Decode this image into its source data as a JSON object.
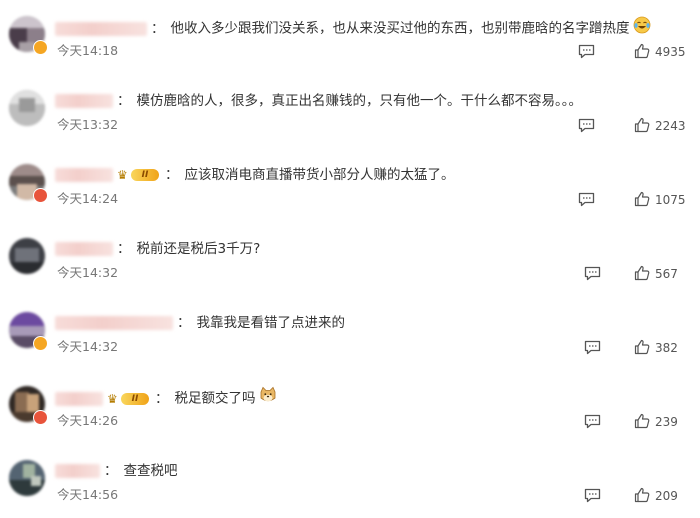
{
  "comments": [
    {
      "text": "他收入多少跟我们没关系，也从来没买过他的东西，也别带鹿晗的名字蹭热度",
      "time": "今天14:18",
      "likes": "4935"
    },
    {
      "text": "模仿鹿晗的人，很多，真正出名赚钱的，只有他一个。干什么都不容易。。。",
      "time": "今天13:32",
      "likes": "2243"
    },
    {
      "text": "应该取消电商直播带货小部分人赚的太猛了。",
      "time": "今天14:24",
      "likes": "1075",
      "badge_level": "II"
    },
    {
      "text": "税前还是税后3千万?",
      "time": "今天14:32",
      "likes": "567"
    },
    {
      "text": "我靠我是看错了点进来的",
      "time": "今天14:32",
      "likes": "382"
    },
    {
      "text": "税足额交了吗",
      "time": "今天14:26",
      "likes": "239",
      "badge_level": "II"
    },
    {
      "text": "查查税吧",
      "time": "今天14:56",
      "likes": "209"
    }
  ],
  "colon": "：",
  "icons": {
    "reply": "comment-reply-icon",
    "like": "thumbs-up-icon",
    "laugh_emoji": "laughing-tears-emoji-icon",
    "doge_emoji": "doge-emoji-icon",
    "crown": "crown-icon"
  }
}
